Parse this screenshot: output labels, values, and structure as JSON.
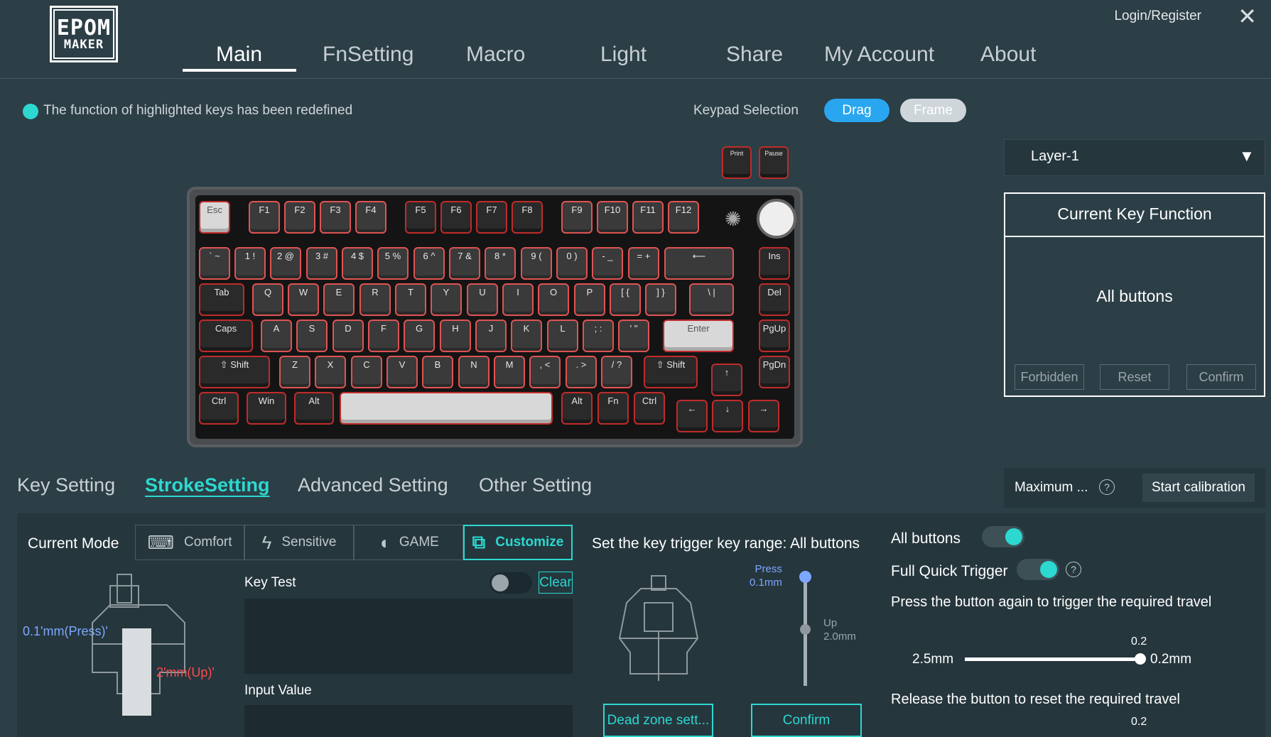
{
  "header": {
    "logo_line1": "EPOM",
    "logo_line2": "MAKER",
    "nav": [
      "Main",
      "FnSetting",
      "Macro",
      "Light",
      "Share",
      "My Account",
      "About"
    ],
    "active_nav": "Main",
    "login": "Login/Register",
    "close_icon": "close-icon"
  },
  "info": {
    "message": "The function of highlighted keys has been redefined",
    "keypad_selection_label": "Keypad Selection",
    "drag": "Drag",
    "frame": "Frame"
  },
  "keyboard": {
    "extra_keys": [
      "Print",
      "Pause"
    ],
    "row_fn": [
      "Esc",
      "F1",
      "F2",
      "F3",
      "F4",
      "F5",
      "F6",
      "F7",
      "F8",
      "F9",
      "F10",
      "F11",
      "F12"
    ],
    "row_num": [
      "` ~",
      "1 !",
      "2 @",
      "3 #",
      "4 $",
      "5 %",
      "6 ^",
      "7 &",
      "8 *",
      "9 (",
      "0 )",
      "- _",
      "= +",
      "⟵",
      "Ins"
    ],
    "row_tab": [
      "Tab",
      "Q",
      "W",
      "E",
      "R",
      "T",
      "Y",
      "U",
      "I",
      "O",
      "P",
      "[ {",
      "] }",
      "\\ |",
      "Del"
    ],
    "row_caps": [
      "Caps",
      "A",
      "S",
      "D",
      "F",
      "G",
      "H",
      "J",
      "K",
      "L",
      "; :",
      "' \"",
      "Enter",
      "PgUp"
    ],
    "row_shift": [
      "⇧ Shift",
      "Z",
      "X",
      "C",
      "V",
      "B",
      "N",
      "M",
      ", <",
      ". >",
      "/ ?",
      "⇧ Shift",
      "↑",
      "PgDn"
    ],
    "row_ctrl": [
      "Ctrl",
      "Win",
      "Alt",
      "",
      "Alt",
      "Fn",
      "Ctrl",
      "←",
      "↓",
      "→"
    ]
  },
  "layer": {
    "value": "Layer-1",
    "arrow": "▼"
  },
  "current_key_function": {
    "title": "Current Key Function",
    "value": "All buttons",
    "buttons": [
      "Forbidden",
      "Reset",
      "Confirm"
    ]
  },
  "setting_tabs": [
    "Key Setting",
    "StrokeSetting",
    "Advanced Setting",
    "Other Setting"
  ],
  "active_setting_tab": "StrokeSetting",
  "calibration": {
    "maximum_label": "Maximum ...",
    "start": "Start calibration"
  },
  "stroke": {
    "current_mode_label": "Current Mode",
    "modes": [
      {
        "label": "Comfort",
        "icon": "keyboard-icon"
      },
      {
        "label": "Sensitive",
        "icon": "lightning-icon"
      },
      {
        "label": "GAME",
        "icon": "pacman-icon"
      },
      {
        "label": "Customize",
        "icon": "customize-icon"
      }
    ],
    "active_mode": "Customize",
    "key_test_label": "Key Test",
    "clear": "Clear",
    "input_value_label": "Input Value",
    "switch_press": "0.1'mm(Press)'",
    "switch_up": "2'mm(Up)'",
    "trigger_label": "Set the key trigger key range: All buttons",
    "press_label_1": "Press",
    "press_label_2": "0.1mm",
    "up_label_1": "Up",
    "up_label_2": "2.0mm",
    "dead_zone": "Dead zone sett...",
    "confirm": "Confirm"
  },
  "quick_trigger": {
    "all_buttons": "All buttons",
    "all_buttons_on": true,
    "full_quick_trigger": "Full Quick Trigger",
    "full_quick_trigger_on": true,
    "press_again": "Press the button again to trigger the required travel",
    "range1_top": "0.2",
    "range1_left": "2.5mm",
    "range1_right": "0.2mm",
    "release": "Release the button to reset the required travel",
    "range2_top": "0.2"
  },
  "colors": {
    "background": "#2c3e46",
    "accent": "#2cd8d0",
    "drag": "#2aa6f0",
    "key_border": "#c12b2b"
  }
}
